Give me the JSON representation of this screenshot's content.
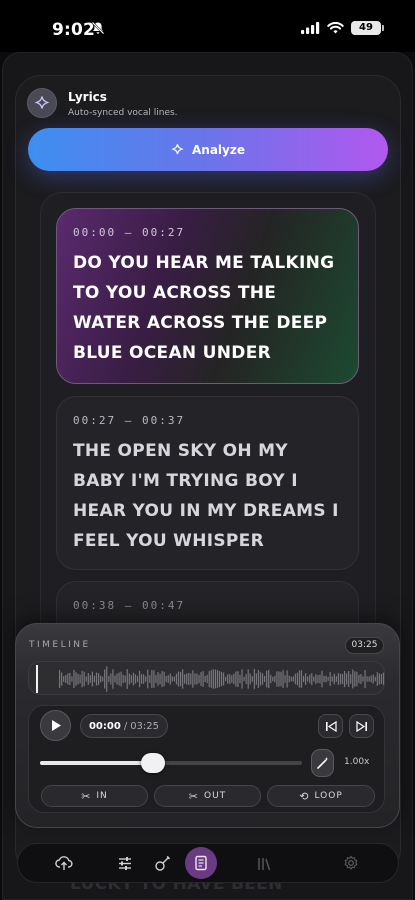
{
  "status_bar": {
    "time": "9:02",
    "battery": "49"
  },
  "header": {
    "title": "Lyrics",
    "subtitle": "Auto-synced vocal lines."
  },
  "analyze_button": {
    "label": "Analyze"
  },
  "lyrics": [
    {
      "time": "00:00 – 00:27",
      "text": "DO YOU HEAR ME TALKING TO YOU ACROSS THE WATER ACROSS THE DEEP BLUE OCEAN UNDER",
      "active": true
    },
    {
      "time": "00:27 – 00:37",
      "text": "THE OPEN SKY OH MY BABY I'M TRYING BOY I HEAR YOU IN MY DREAMS I FEEL YOU WHISPER",
      "active": false
    },
    {
      "time": "00:38 – 00:47",
      "text": "",
      "active": false
    }
  ],
  "background_peek_text": "LUCKY TO HAVE BEEN",
  "timeline": {
    "label": "TIMELINE",
    "total": "03:25",
    "current": "00:00",
    "duration": "03:25",
    "progress_fraction": 0.43,
    "speed": "1.00x",
    "chips": {
      "in": "IN",
      "out": "OUT",
      "loop": "LOOP"
    }
  },
  "nav": {
    "items": [
      {
        "name": "upload-icon",
        "active": false
      },
      {
        "name": "sliders-icon",
        "active": false
      },
      {
        "name": "guitar-icon",
        "active": false
      },
      {
        "name": "lyrics-icon",
        "active": true
      },
      {
        "name": "library-icon",
        "active": false
      },
      {
        "name": "settings-icon",
        "active": false
      }
    ]
  },
  "colors": {
    "accent_start": "#3d8ff0",
    "accent_end": "#b158ef",
    "active_nav": "#6a3b82"
  }
}
